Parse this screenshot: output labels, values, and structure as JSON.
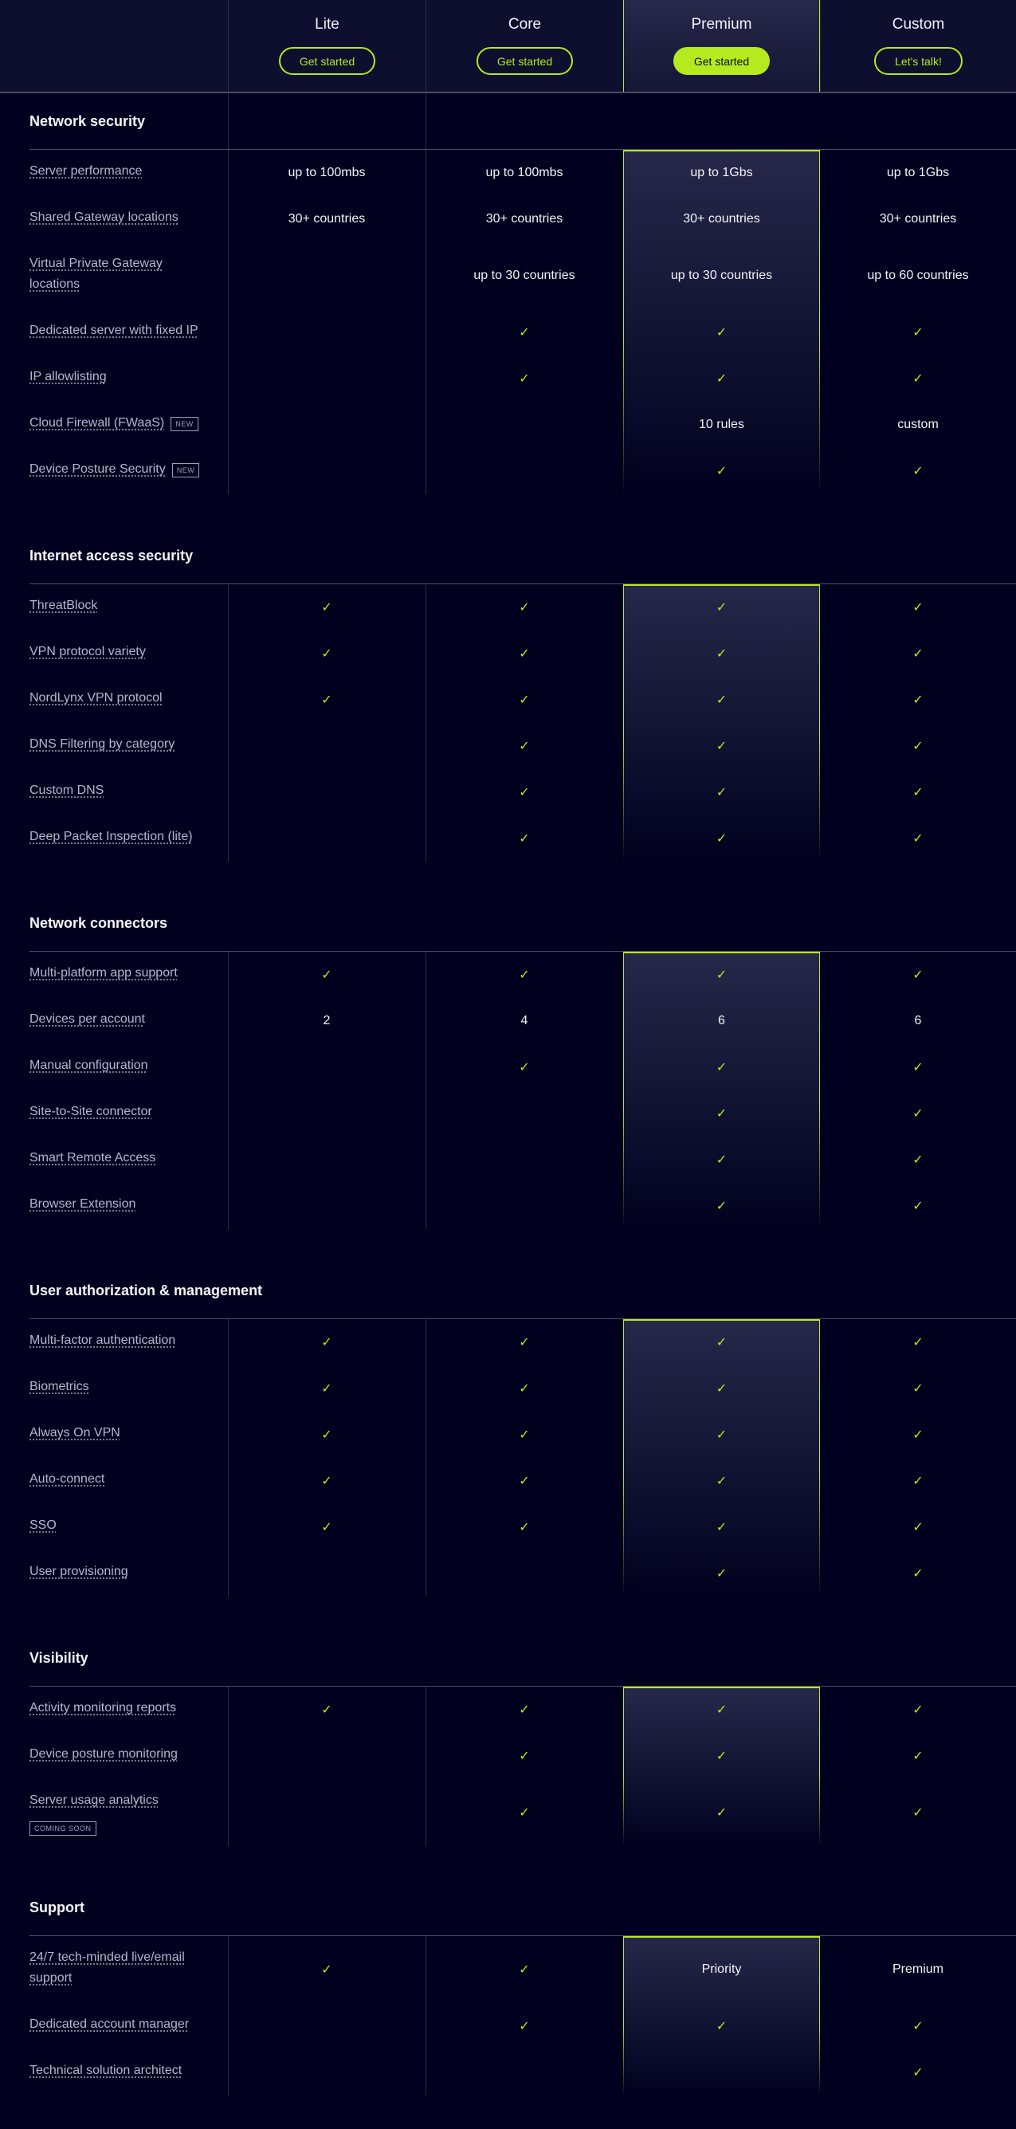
{
  "plans": [
    {
      "name": "Lite",
      "cta": "Get started",
      "highlighted": false
    },
    {
      "name": "Core",
      "cta": "Get started",
      "highlighted": false
    },
    {
      "name": "Premium",
      "cta": "Get started",
      "highlighted": true
    },
    {
      "name": "Custom",
      "cta": "Let's talk!",
      "highlighted": false
    }
  ],
  "colors": {
    "accent": "#b4ea1e",
    "background": "#01011f",
    "header_background": "#0e0f2f"
  },
  "icons": {
    "included": "check-icon"
  },
  "check_glyph": "✓",
  "sections": [
    {
      "title": "Network security",
      "rows": [
        {
          "feature": "Server performance",
          "values": [
            "up to 100mbs",
            "up to 100mbs",
            "up to 1Gbs",
            "up to 1Gbs"
          ]
        },
        {
          "feature": "Shared Gateway locations",
          "values": [
            "30+ countries",
            "30+ countries",
            "30+ countries",
            "30+ countries"
          ]
        },
        {
          "feature": "Virtual Private Gateway locations",
          "tall": true,
          "values": [
            "",
            "up to 30 countries",
            "up to 30 countries",
            "up to 60 countries"
          ]
        },
        {
          "feature": "Dedicated server with fixed IP",
          "values": [
            "",
            "check",
            "check",
            "check"
          ]
        },
        {
          "feature": "IP allowlisting",
          "values": [
            "",
            "check",
            "check",
            "check"
          ]
        },
        {
          "feature": "Cloud Firewall (FWaaS)",
          "badge": "NEW",
          "values": [
            "",
            "",
            "10 rules",
            "custom"
          ]
        },
        {
          "feature": "Device Posture Security",
          "badge": "NEW",
          "values": [
            "",
            "",
            "check",
            "check"
          ]
        }
      ]
    },
    {
      "title": "Internet access security",
      "rows": [
        {
          "feature": "ThreatBlock",
          "values": [
            "check",
            "check",
            "check",
            "check"
          ]
        },
        {
          "feature": "VPN protocol variety",
          "values": [
            "check",
            "check",
            "check",
            "check"
          ]
        },
        {
          "feature": "NordLynx VPN protocol",
          "values": [
            "check",
            "check",
            "check",
            "check"
          ]
        },
        {
          "feature": "DNS Filtering by category",
          "values": [
            "",
            "check",
            "check",
            "check"
          ]
        },
        {
          "feature": "Custom DNS",
          "values": [
            "",
            "check",
            "check",
            "check"
          ]
        },
        {
          "feature": "Deep Packet Inspection (lite)",
          "values": [
            "",
            "check",
            "check",
            "check"
          ]
        }
      ]
    },
    {
      "title": "Network connectors",
      "rows": [
        {
          "feature": "Multi-platform app support",
          "values": [
            "check",
            "check",
            "check",
            "check"
          ]
        },
        {
          "feature": "Devices per account",
          "values": [
            "2",
            "4",
            "6",
            "6"
          ]
        },
        {
          "feature": "Manual configuration",
          "values": [
            "",
            "check",
            "check",
            "check"
          ]
        },
        {
          "feature": "Site-to-Site connector",
          "values": [
            "",
            "",
            "check",
            "check"
          ]
        },
        {
          "feature": "Smart Remote Access",
          "values": [
            "",
            "",
            "check",
            "check"
          ]
        },
        {
          "feature": "Browser Extension",
          "values": [
            "",
            "",
            "check",
            "check"
          ]
        }
      ]
    },
    {
      "title": "User authorization & management",
      "rows": [
        {
          "feature": "Multi-factor authentication",
          "values": [
            "check",
            "check",
            "check",
            "check"
          ]
        },
        {
          "feature": "Biometrics",
          "values": [
            "check",
            "check",
            "check",
            "check"
          ]
        },
        {
          "feature": "Always On VPN",
          "values": [
            "check",
            "check",
            "check",
            "check"
          ]
        },
        {
          "feature": "Auto-connect",
          "values": [
            "check",
            "check",
            "check",
            "check"
          ]
        },
        {
          "feature": "SSO",
          "values": [
            "check",
            "check",
            "check",
            "check"
          ]
        },
        {
          "feature": "User provisioning",
          "values": [
            "",
            "",
            "check",
            "check"
          ]
        }
      ]
    },
    {
      "title": "Visibility",
      "rows": [
        {
          "feature": "Activity monitoring reports",
          "values": [
            "check",
            "check",
            "check",
            "check"
          ]
        },
        {
          "feature": "Device posture monitoring",
          "values": [
            "",
            "check",
            "check",
            "check"
          ]
        },
        {
          "feature": "Server usage analytics",
          "badge": "COMING SOON",
          "badge_below": true,
          "tall": true,
          "values": [
            "",
            "check",
            "check",
            "check"
          ]
        }
      ]
    },
    {
      "title": "Support",
      "rows": [
        {
          "feature": "24/7 tech-minded live/email support",
          "tall": true,
          "values": [
            "check",
            "check",
            "Priority",
            "Premium"
          ]
        },
        {
          "feature": "Dedicated account manager",
          "values": [
            "",
            "check",
            "check",
            "check"
          ]
        },
        {
          "feature": "Technical solution architect",
          "values": [
            "",
            "",
            "",
            "check"
          ]
        }
      ]
    }
  ]
}
